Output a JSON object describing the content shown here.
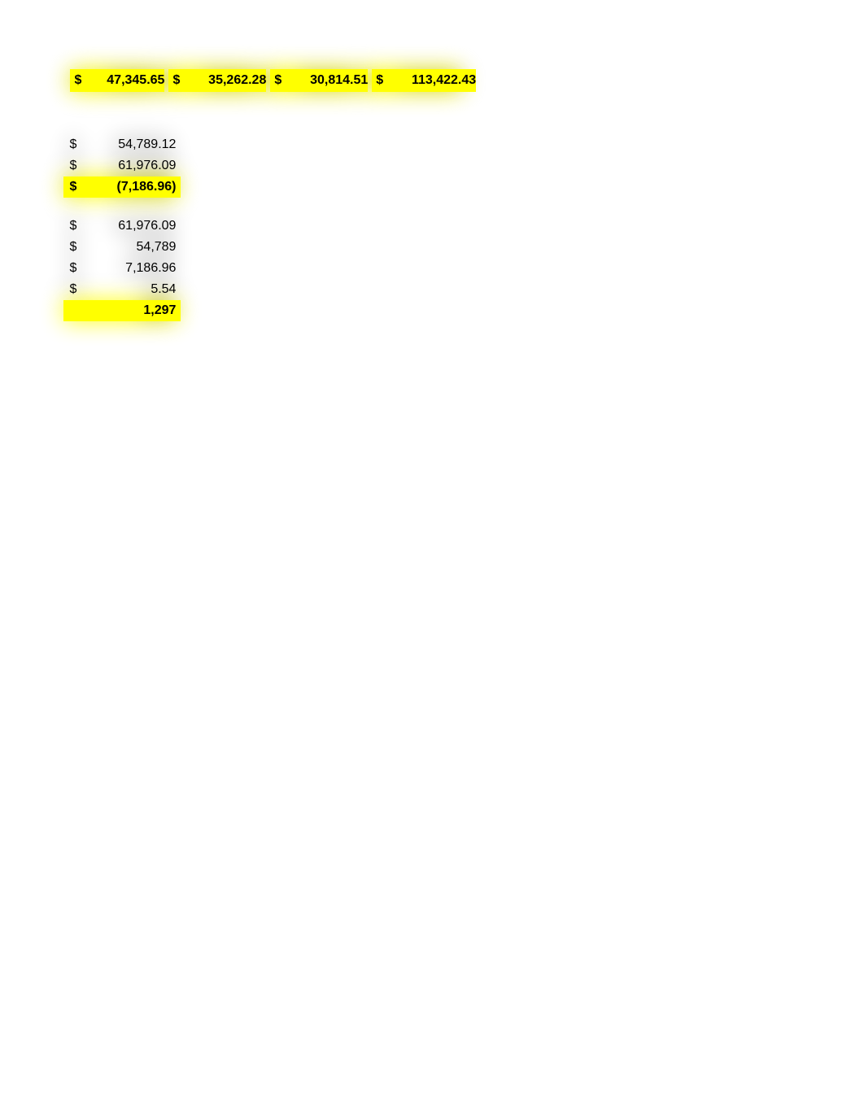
{
  "currency_symbol": "$",
  "top_row": {
    "values": [
      "47,345.65",
      "35,262.28",
      "30,814.51",
      "113,422.43"
    ]
  },
  "block1": {
    "r1": {
      "sym": "$",
      "val": "54,789.12"
    },
    "r2": {
      "sym": "$",
      "val": "61,976.09"
    },
    "r3": {
      "sym": "$",
      "val": "(7,186.96)"
    }
  },
  "block2": {
    "r1": {
      "sym": "$",
      "val": "61,976.09"
    },
    "r2": {
      "sym": "$",
      "val": "54,789"
    },
    "r3": {
      "sym": "$",
      "val": "7,186.96"
    },
    "r4": {
      "sym": "$",
      "val": "5.54"
    },
    "r5": {
      "sym": "",
      "val": "1,297"
    }
  }
}
